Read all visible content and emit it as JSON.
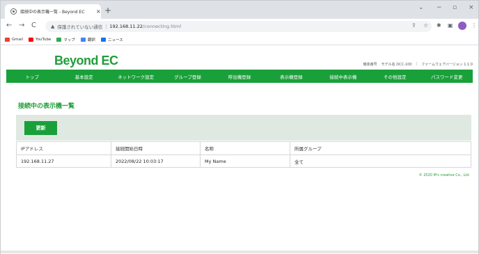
{
  "browser": {
    "tab": {
      "title": "接続中の表示機一覧 - Beyond EC",
      "close": "×",
      "new_tab": "+"
    },
    "window_controls": {
      "menu": "⌄",
      "minimize": "−",
      "restore": "▫",
      "close": "×"
    },
    "nav": {
      "back": "←",
      "forward": "→",
      "reload": "C"
    },
    "address": {
      "warning_icon": "▲",
      "insecure_label": "保護されていない通信",
      "separator": "|",
      "host": "192.168.11.22",
      "path": "/connecting.html"
    },
    "toolbar_icons": {
      "share": "⇪",
      "star": "☆",
      "extensions": "✱",
      "sidebar": "▣",
      "more": "⋮"
    },
    "bookmarks": [
      {
        "label": "Gmail",
        "color": "#ea4335"
      },
      {
        "label": "YouTube",
        "color": "#ff0000"
      },
      {
        "label": "マップ",
        "color": "#34a853"
      },
      {
        "label": "翻訳",
        "color": "#4285f4"
      },
      {
        "label": "ニュース",
        "color": "#1a73e8"
      }
    ]
  },
  "site": {
    "logo": "Beyond EC",
    "device_info": {
      "serial_label": "機体番号",
      "model_label": "モデル名 DCC-100",
      "separator": "|",
      "firmware_label": "ファームウェアバージョン 1.1.0"
    },
    "nav": [
      "トップ",
      "基本設定",
      "ネットワーク設定",
      "グループ登録",
      "呼出機登録",
      "表示機登録",
      "接続中表示機",
      "その他設定",
      "パスワード変更"
    ],
    "page_title": "接続中の表示機一覧",
    "refresh_button": "更新",
    "table": {
      "headers": [
        "IPアドレス",
        "接続開始日時",
        "名称",
        "所属グループ"
      ],
      "rows": [
        [
          "192.168.11.27",
          "2022/08/22 10:03:17",
          "My Name",
          "全て"
        ]
      ]
    },
    "copyright": "© 2020 M's creative Co., Ltd."
  },
  "colors": {
    "brand_green": "#1aa03a",
    "panel_bg": "#dfe9e1"
  }
}
